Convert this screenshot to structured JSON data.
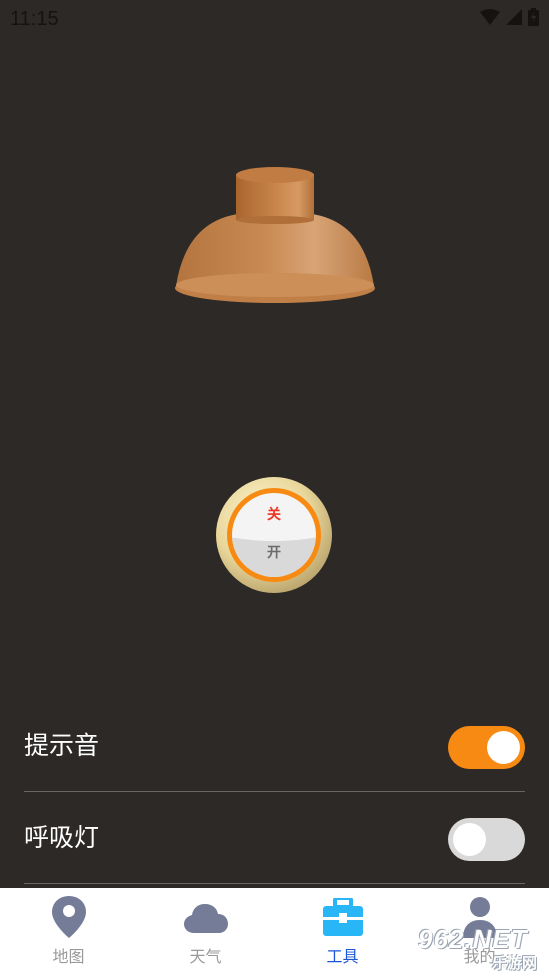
{
  "status_bar": {
    "time": "11:15"
  },
  "knob": {
    "off_label": "关",
    "on_label": "开"
  },
  "settings": [
    {
      "label": "提示音",
      "enabled": true
    },
    {
      "label": "呼吸灯",
      "enabled": false
    }
  ],
  "nav": {
    "items": [
      {
        "label": "地图",
        "icon": "map-pin-icon",
        "active": false
      },
      {
        "label": "天气",
        "icon": "cloud-icon",
        "active": false
      },
      {
        "label": "工具",
        "icon": "toolbox-icon",
        "active": true
      },
      {
        "label": "我的",
        "icon": "person-icon",
        "active": false
      }
    ]
  },
  "watermark": {
    "brand": "962.NET",
    "sub": "乐游网"
  },
  "colors": {
    "background": "#2d2926",
    "accent_orange": "#f68a12",
    "lamp": "#c88a55",
    "nav_active": "#1a56d6"
  }
}
